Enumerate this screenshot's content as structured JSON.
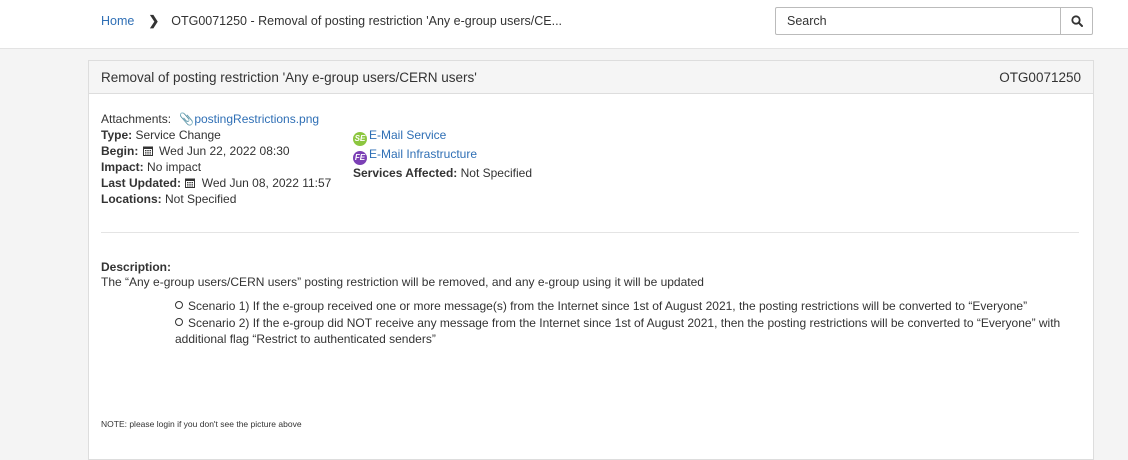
{
  "breadcrumb": {
    "home": "Home",
    "current": "OTG0071250 - Removal of posting restriction 'Any e-group users/CE..."
  },
  "search": {
    "placeholder": "Search"
  },
  "card": {
    "title": "Removal of posting restriction 'Any e-group users/CERN users'",
    "id": "OTG0071250"
  },
  "meta": {
    "attachments_label": "Attachments:",
    "attachment_file": "postingRestrictions.png",
    "type_label": "Type:",
    "type_value": "Service Change",
    "begin_label": "Begin:",
    "begin_value": "Wed Jun 22, 2022 08:30",
    "impact_label": "Impact:",
    "impact_value": "No impact",
    "updated_label": "Last Updated:",
    "updated_value": "Wed Jun 08, 2022 11:57",
    "locations_label": "Locations:",
    "locations_value": "Not Specified"
  },
  "services": {
    "items": [
      {
        "badge": "SE",
        "label": "E-Mail Service",
        "color": "#8cc63f"
      },
      {
        "badge": "FE",
        "label": "E-Mail Infrastructure",
        "color": "#7b3fb5"
      }
    ],
    "affected_label": "Services Affected:",
    "affected_value": "Not Specified"
  },
  "description": {
    "title": "Description:",
    "text": "The “Any e-group users/CERN users” posting restriction will be removed, and any e-group using it will be updated",
    "scenarios": [
      "Scenario 1) If the e-group received one or more message(s) from the Internet since 1st of August 2021, the posting restrictions will be converted to “Everyone”",
      "Scenario 2) If the e-group did NOT receive any message from the Internet since 1st of August 2021, then the posting restrictions will be converted to “Everyone” with additional flag “Restrict to authenticated senders”"
    ]
  },
  "note": "NOTE: please login if you don't see the picture above",
  "colors": {
    "link": "#2f6fb5",
    "header_bg": "#f5f5f5"
  }
}
